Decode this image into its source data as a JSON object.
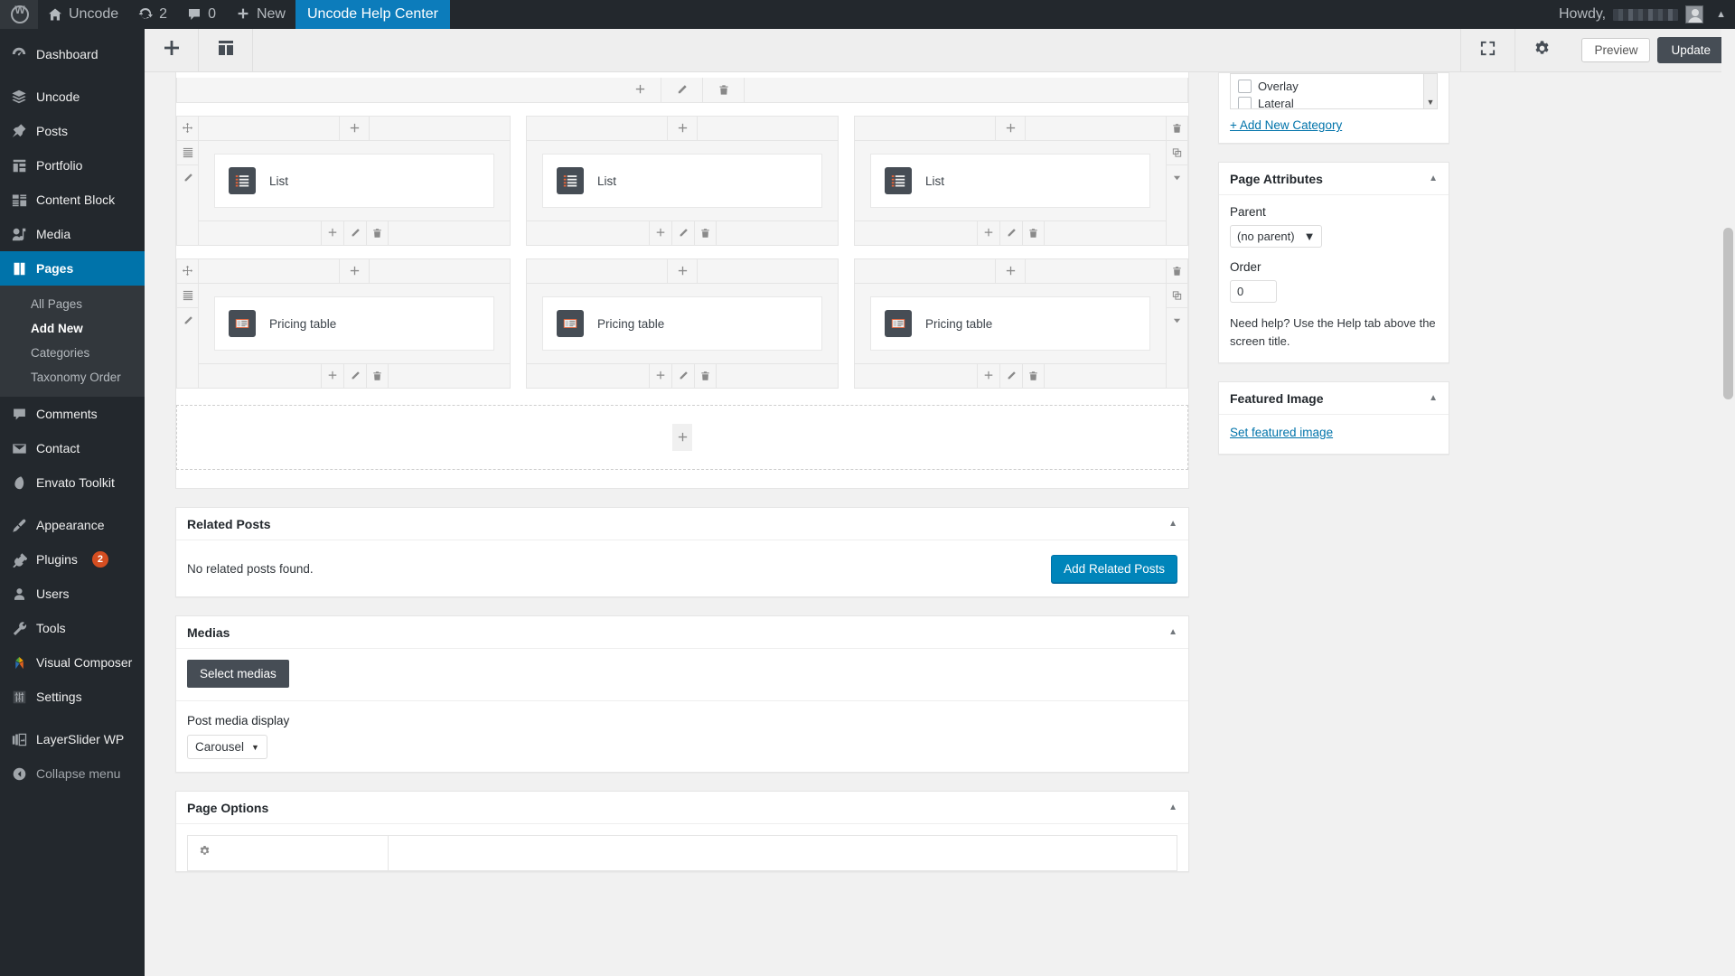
{
  "adminbar": {
    "logo_icon": "wordpress-logo-icon",
    "site_name": "Uncode",
    "site_icon": "home-icon",
    "updates_icon": "updates-icon",
    "updates_count": "2",
    "comments_icon": "comment-bubble-icon",
    "comments_count": "0",
    "new_icon": "plus-icon",
    "new_label": "New",
    "active_item": "Uncode Help Center",
    "howdy_label": "Howdy,",
    "howdy_user": "",
    "avatar_icon": "user-avatar-icon",
    "collapse_icon": "caret-up-icon"
  },
  "sidebar": {
    "items": [
      {
        "label": "Dashboard",
        "icon": "dashboard-icon",
        "current": false
      },
      {
        "label": "Uncode",
        "icon": "layers-icon",
        "current": false
      },
      {
        "label": "Posts",
        "icon": "pin-icon",
        "current": false
      },
      {
        "label": "Portfolio",
        "icon": "portfolio-grid-icon",
        "current": false
      },
      {
        "label": "Content Block",
        "icon": "content-block-icon",
        "current": false
      },
      {
        "label": "Media",
        "icon": "media-icon",
        "current": false
      },
      {
        "label": "Pages",
        "icon": "pages-icon",
        "current": true
      },
      {
        "label": "Comments",
        "icon": "comment-bubble-icon",
        "current": false
      },
      {
        "label": "Contact",
        "icon": "envelope-icon",
        "current": false
      },
      {
        "label": "Envato Toolkit",
        "icon": "envato-leaf-icon",
        "current": false
      },
      {
        "label": "Appearance",
        "icon": "paintbrush-icon",
        "current": false
      },
      {
        "label": "Plugins",
        "icon": "plug-icon",
        "current": false,
        "badge": "2"
      },
      {
        "label": "Users",
        "icon": "user-icon",
        "current": false
      },
      {
        "label": "Tools",
        "icon": "wrench-icon",
        "current": false
      },
      {
        "label": "Visual Composer",
        "icon": "visual-composer-icon",
        "current": false
      },
      {
        "label": "Settings",
        "icon": "sliders-icon",
        "current": false
      },
      {
        "label": "LayerSlider WP",
        "icon": "slides-icon",
        "current": false
      }
    ],
    "submenu": [
      {
        "label": "All Pages",
        "current": false
      },
      {
        "label": "Add New",
        "current": true
      },
      {
        "label": "Categories",
        "current": false
      },
      {
        "label": "Taxonomy Order",
        "current": false
      }
    ],
    "collapse": {
      "label": "Collapse menu",
      "icon": "collapse-arrow-icon"
    }
  },
  "toolbar": {
    "add_element_icon": "plus-icon",
    "layout_icon": "layout-columns-icon",
    "fullscreen_icon": "fullscreen-icon",
    "settings_icon": "gear-icon",
    "preview_label": "Preview",
    "update_label": "Update"
  },
  "builder": {
    "row_controls": [
      {
        "icon": "move-cross-icon",
        "name": "drag-row-handle"
      },
      {
        "icon": "columns-layout-icon",
        "name": "row-layout-button"
      },
      {
        "icon": "pencil-icon",
        "name": "edit-row-button"
      }
    ],
    "row_right_controls": [
      {
        "icon": "trash-icon",
        "name": "delete-row-button"
      },
      {
        "icon": "copy-icon",
        "name": "duplicate-row-button"
      },
      {
        "icon": "caret-down-icon",
        "name": "row-more-button"
      }
    ],
    "element_controls": [
      {
        "icon": "plus-icon",
        "name": "add-element-button"
      },
      {
        "icon": "pencil-icon",
        "name": "edit-element-button"
      },
      {
        "icon": "trash-icon",
        "name": "delete-element-button"
      }
    ],
    "add_icon": "plus-icon",
    "rows": [
      {
        "columns": [
          {
            "element": "List",
            "icon": "list-element-icon"
          },
          {
            "element": "List",
            "icon": "list-element-icon"
          },
          {
            "element": "List",
            "icon": "list-element-icon"
          }
        ]
      },
      {
        "columns": [
          {
            "element": "Pricing table",
            "icon": "pricing-table-element-icon"
          },
          {
            "element": "Pricing table",
            "icon": "pricing-table-element-icon"
          },
          {
            "element": "Pricing table",
            "icon": "pricing-table-element-icon"
          }
        ]
      }
    ]
  },
  "related_posts": {
    "title": "Related Posts",
    "toggle_icon": "caret-up-icon",
    "empty_text": "No related posts found.",
    "add_button": "Add Related Posts"
  },
  "medias": {
    "title": "Medias",
    "toggle_icon": "caret-up-icon",
    "select_button": "Select medias",
    "display_label": "Post media display",
    "display_value": "Carousel",
    "caret_icon": "caret-down-icon"
  },
  "page_options": {
    "title": "Page Options",
    "toggle_icon": "caret-up-icon"
  },
  "categories_panel": {
    "items": [
      {
        "label": "Overlay",
        "checked": false
      },
      {
        "label": "Lateral",
        "checked": false
      }
    ],
    "add_new_link": "+ Add New Category",
    "scroll_caret_icon": "caret-down-icon"
  },
  "page_attributes": {
    "title": "Page Attributes",
    "toggle_icon": "caret-up-icon",
    "parent_label": "Parent",
    "parent_value": "(no parent)",
    "order_label": "Order",
    "order_value": "0",
    "help_text": "Need help? Use the Help tab above the screen title.",
    "caret_icon": "caret-down-icon"
  },
  "featured_image": {
    "title": "Featured Image",
    "toggle_icon": "caret-up-icon",
    "set_link": "Set featured image"
  },
  "colors": {
    "admin_bar": "#23282d",
    "menu_current": "#0073aa",
    "accent_blue": "#0085ba",
    "dark_button": "#464d55",
    "badge_orange": "#d54e21",
    "link_blue": "#0073aa"
  }
}
